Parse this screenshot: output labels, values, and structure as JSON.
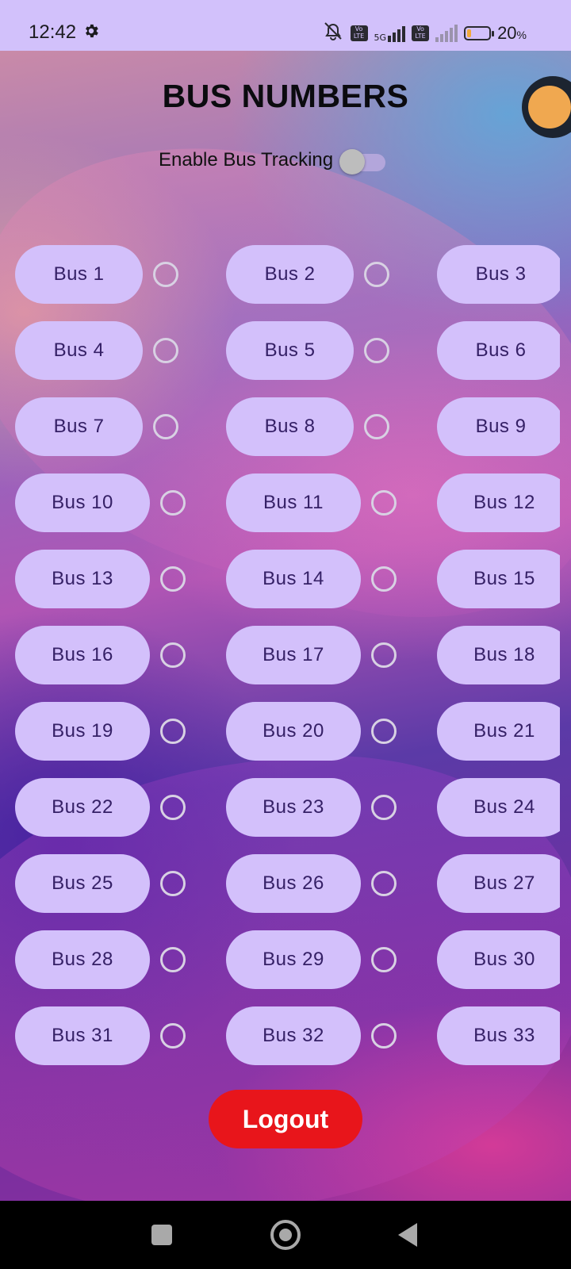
{
  "status_bar": {
    "time": "12:42",
    "network_label": "5G",
    "volte_label_1": "Vo LTE",
    "volte_label_2": "Vo LTE",
    "battery_percent": "20",
    "battery_unit": "%",
    "battery_level": 0.2
  },
  "header": {
    "title": "BUS NUMBERS"
  },
  "tracking": {
    "label": "Enable Bus Tracking",
    "enabled": false
  },
  "buses": [
    {
      "label": "Bus 1"
    },
    {
      "label": "Bus 2"
    },
    {
      "label": "Bus 3"
    },
    {
      "label": "Bus 4"
    },
    {
      "label": "Bus 5"
    },
    {
      "label": "Bus 6"
    },
    {
      "label": "Bus 7"
    },
    {
      "label": "Bus 8"
    },
    {
      "label": "Bus 9"
    },
    {
      "label": "Bus 10"
    },
    {
      "label": "Bus 11"
    },
    {
      "label": "Bus 12"
    },
    {
      "label": "Bus 13"
    },
    {
      "label": "Bus 14"
    },
    {
      "label": "Bus 15"
    },
    {
      "label": "Bus 16"
    },
    {
      "label": "Bus 17"
    },
    {
      "label": "Bus 18"
    },
    {
      "label": "Bus 19"
    },
    {
      "label": "Bus 20"
    },
    {
      "label": "Bus 21"
    },
    {
      "label": "Bus 22"
    },
    {
      "label": "Bus 23"
    },
    {
      "label": "Bus 24"
    },
    {
      "label": "Bus 25"
    },
    {
      "label": "Bus 26"
    },
    {
      "label": "Bus 27"
    },
    {
      "label": "Bus 28"
    },
    {
      "label": "Bus 29"
    },
    {
      "label": "Bus 30"
    },
    {
      "label": "Bus 31"
    },
    {
      "label": "Bus 32"
    },
    {
      "label": "Bus 33"
    }
  ],
  "logout_label": "Logout",
  "colors": {
    "status_bar_bg": "#d2c1fb",
    "bus_button_bg": "#d3c0fb",
    "bus_button_text": "#352066",
    "logout_bg": "#e8151b",
    "radio_border": "#d8d1e3"
  },
  "icons": {
    "status": [
      "gear-icon",
      "mute-icon",
      "volte-icon",
      "signal-icon",
      "battery-icon"
    ],
    "nav": [
      "recents-icon",
      "home-icon",
      "back-icon"
    ]
  }
}
